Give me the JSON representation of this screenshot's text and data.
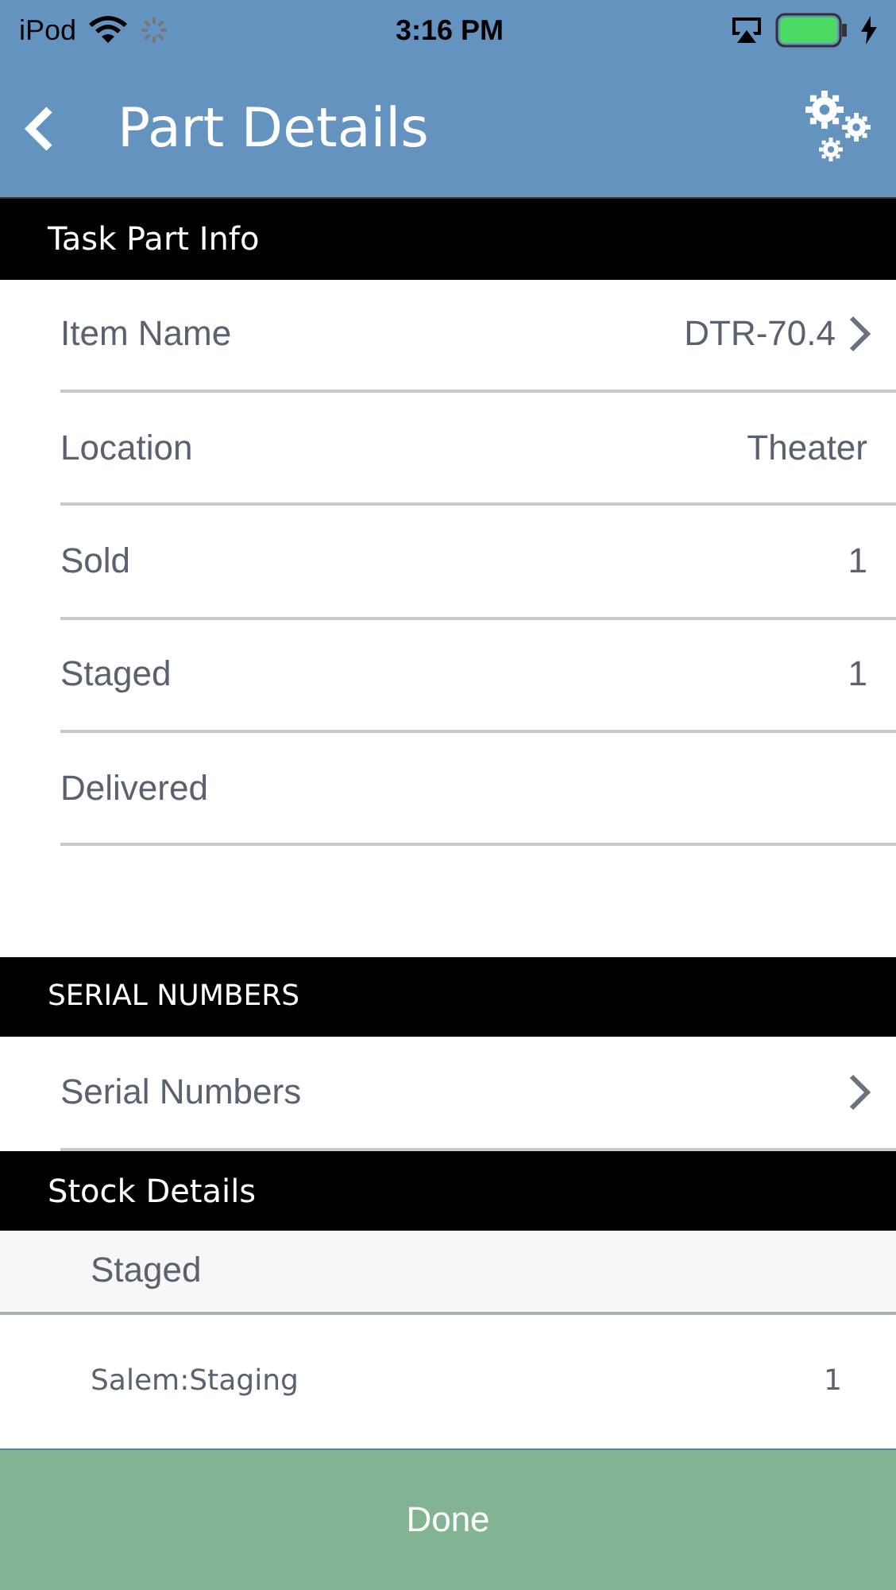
{
  "status_bar": {
    "carrier": "iPod",
    "time": "3:16 PM"
  },
  "nav": {
    "title": "Part Details"
  },
  "sections": [
    {
      "kind": "fields",
      "title": "Task Part Info",
      "rows": [
        {
          "label": "Item Name",
          "value": "DTR-70.4",
          "link": true
        },
        {
          "label": "Location",
          "value": "Theater",
          "link": false
        },
        {
          "label": "Sold",
          "value": "1",
          "link": false
        },
        {
          "label": "Staged",
          "value": "1",
          "link": false
        },
        {
          "label": "Delivered",
          "link": false
        }
      ]
    },
    {
      "kind": "fields",
      "title": "SERIAL NUMBERS",
      "rows": [
        {
          "label": "Serial Numbers",
          "link": true
        }
      ]
    },
    {
      "kind": "stock",
      "title": "Stock Details",
      "group": "Staged",
      "rows": [
        {
          "label": "Salem:Staging",
          "value": "1"
        }
      ]
    }
  ],
  "footer": {
    "button": "Done"
  }
}
